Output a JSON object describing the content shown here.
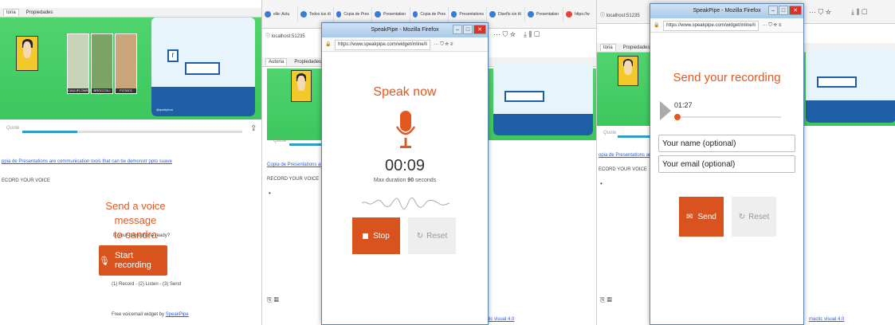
{
  "panel1": {
    "tabs": [
      "toria",
      "Propiedades"
    ],
    "card_captions": [
      "CAULIFLOWER",
      "BROCCOLI",
      "POTATO"
    ],
    "slide_letter": "r",
    "slide_footer": "@quizlyhoo",
    "progress": 0.25,
    "caption_mark": "Quote",
    "link_text": "ppia de Presentations are communication tools that can be demonstr",
    "link_tail": "ppto suave",
    "record_label": "ECORD YOUR VOICE",
    "voice_title_line1": "Send a voice message",
    "voice_title_line2": "to sandra",
    "mic_question": "Is your microphone ready?",
    "start_button": "Start recording",
    "steps": "(1) Record - (2) Listen - (3) Send",
    "footer_text": "Free voicemail widget by",
    "footer_link": "SpeakPipe"
  },
  "panel2": {
    "browser_tabs": [
      "elle: Actu",
      "Todos tus di",
      "Copia de Pres",
      "Presentation",
      "Copia de Pres",
      "Presentations",
      "Diseño sin tít",
      "Presentation",
      "https://w"
    ],
    "address": "localhost:51235",
    "side_tabs": [
      "Autoría",
      "Propiedades"
    ],
    "window_title": "SpeakPipe - Mozilla Firefox",
    "window_url": "https://www.speakpipe.com/widget/inline/li",
    "speak_now": "Speak now",
    "timer": "00:09",
    "max_duration_prefix": "Max duration",
    "max_duration_value": "90",
    "max_duration_suffix": "seconds",
    "stop_button": "Stop",
    "reset_button": "Reset",
    "caption_mark": "Quote",
    "link_text": "Copia de Presentations are c",
    "record_label": "RECORD YOUR VOICE",
    "footer_link": "mactic visual 4.0"
  },
  "panel3": {
    "address": "localhost:51235",
    "side_tabs": [
      "toria",
      "Propiedades"
    ],
    "window_title": "SpeakPipe - Mozilla Firefox",
    "window_url": "https://www.speakpipe.com/widget/inline/li",
    "send_title": "Send your recording",
    "playback_time": "01:27",
    "name_placeholder": "Your name (optional)",
    "email_placeholder": "Your email (optional)",
    "send_button": "Send",
    "reset_button": "Reset",
    "caption_mark": "Quote",
    "link_text": "opia de Presentations are co",
    "record_label": "ECORD YOUR VOICE",
    "footer_link": "mactic visual 4.0"
  },
  "colors": {
    "accent_orange": "#d9531e",
    "title_orange": "#e2581f",
    "green": "#3ec75e",
    "blue": "#1e5fa8"
  }
}
